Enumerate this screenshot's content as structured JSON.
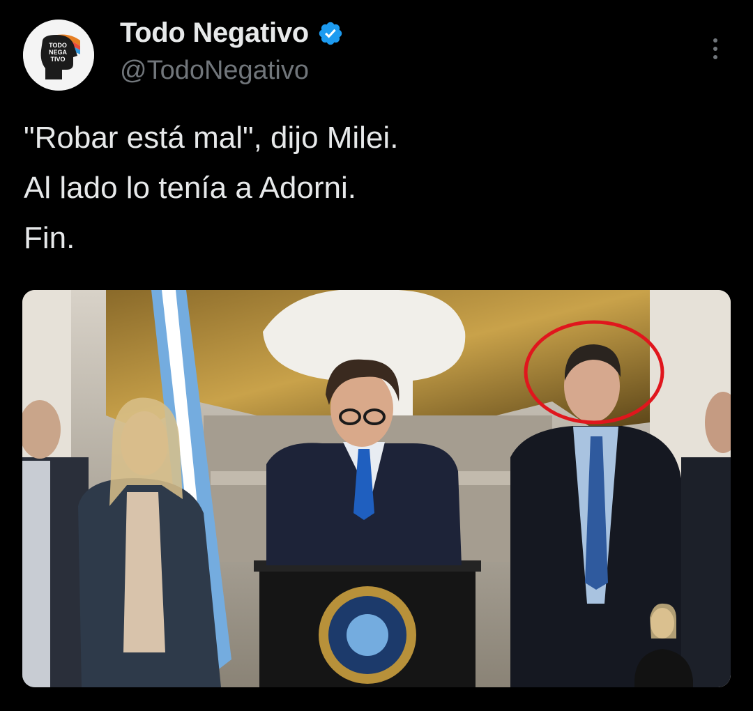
{
  "author": {
    "display_name": "Todo Negativo",
    "handle": "@TodoNegativo",
    "verified": true,
    "avatar_logo_lines": [
      "TODO",
      "NEGA",
      "TIVO"
    ]
  },
  "tweet": {
    "text_lines": [
      "\"Robar está mal\", dijo Milei.",
      "Al lado lo tenía a Adorni.",
      "Fin."
    ]
  },
  "media": {
    "alt_icon": "photo-press-conference"
  },
  "icons": {
    "verified": "verified-badge-icon",
    "more": "more-options-icon"
  },
  "colors": {
    "background": "#000000",
    "text": "#e7e9ea",
    "secondary_text": "#71767b",
    "verified_blue": "#1d9bf0",
    "highlight_circle": "#e0161d"
  }
}
